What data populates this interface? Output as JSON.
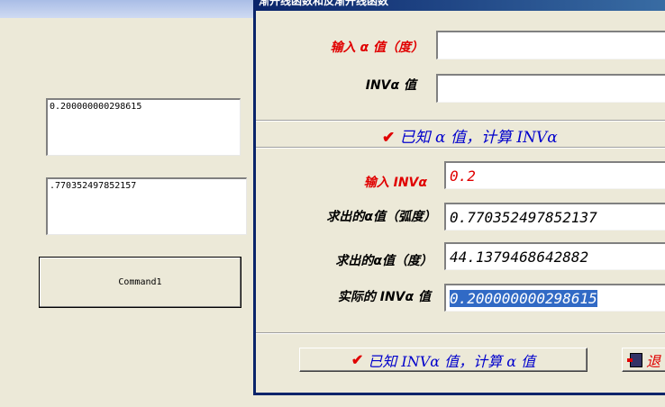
{
  "bg_form": {
    "textbox1_value": "0.200000000298615",
    "textbox2_value": ".770352497852157",
    "command_button_label": "Command1"
  },
  "dialog": {
    "title": "渐开线函数和反渐开线函数",
    "top_section": {
      "alpha_label": "输入 α 值（度）",
      "alpha_value": "",
      "inv_label": "INVα 值",
      "inv_value": ""
    },
    "banner_known_alpha": "已知  α  值，计算  INVα",
    "bottom_section": {
      "inv_input_label": "输入 INVα",
      "inv_input_value": "0.2",
      "alpha_rad_label": "求出的α值（弧度）",
      "alpha_rad_value": "0.770352497852137",
      "alpha_deg_label": "求出的α值（度）",
      "alpha_deg_value": "44.1379468642882",
      "actual_inv_label": "实际的 INVα 值",
      "actual_inv_value": "0.200000000298615"
    },
    "calc_button_label": "已知  INVα  值，计算  α  值",
    "exit_button_label": "退"
  },
  "colors": {
    "label_red": "#e00000",
    "label_blue": "#0000cc",
    "selection": "#316ac5",
    "window_bg": "#ECE9D8"
  },
  "icons": [
    "check-icon",
    "exit-door-icon"
  ]
}
